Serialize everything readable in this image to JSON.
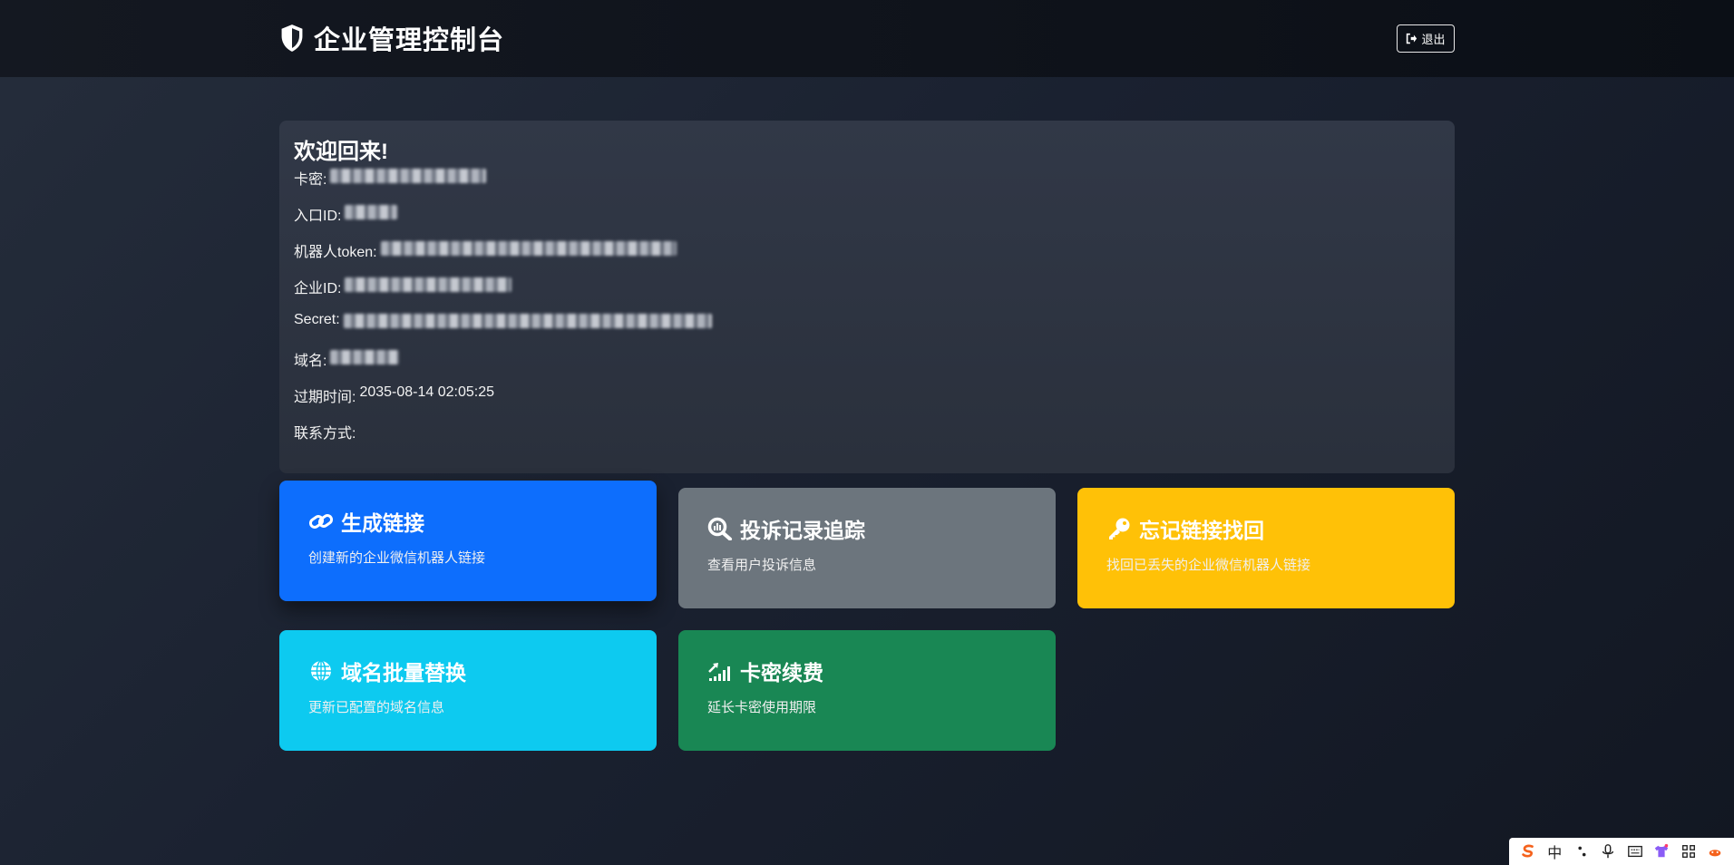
{
  "app": {
    "title": "企业管理控制台",
    "logout_label": "退出"
  },
  "welcome": {
    "heading": "欢迎回来!",
    "fields": [
      {
        "label": "卡密:",
        "value": ""
      },
      {
        "label": "入口ID:",
        "value": ""
      },
      {
        "label": "机器人token:",
        "value": ""
      },
      {
        "label": "企业ID:",
        "value": ""
      },
      {
        "label": "Secret:",
        "value": ""
      },
      {
        "label": "域名:",
        "value": ""
      },
      {
        "label": "过期时间:",
        "value": "2035-08-14 02:05:25"
      },
      {
        "label": "联系方式:",
        "value": ""
      }
    ]
  },
  "actions": [
    {
      "title": "生成链接",
      "desc": "创建新的企业微信机器人链接",
      "icon": "link-icon",
      "color": "#0d6efd"
    },
    {
      "title": "投诉记录追踪",
      "desc": "查看用户投诉信息",
      "icon": "search-chart-icon",
      "color": "#6c757d"
    },
    {
      "title": "忘记链接找回",
      "desc": "找回已丢失的企业微信机器人链接",
      "icon": "key-icon",
      "color": "#ffc107"
    },
    {
      "title": "域名批量替换",
      "desc": "更新已配置的域名信息",
      "icon": "globe-icon",
      "color": "#0dcaf0"
    },
    {
      "title": "卡密续费",
      "desc": "延长卡密使用期限",
      "icon": "growth-icon",
      "color": "#198754"
    }
  ],
  "taskbar": {
    "ime_mode": "中"
  }
}
